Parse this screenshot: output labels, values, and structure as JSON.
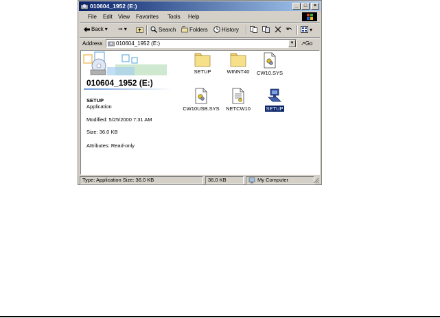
{
  "window": {
    "title": "010604_1952 (E:)",
    "controls": {
      "minimize": "_",
      "maximize": "□",
      "close": "×"
    }
  },
  "menubar": {
    "items": [
      "File",
      "Edit",
      "View",
      "Favorites",
      "Tools",
      "Help"
    ]
  },
  "toolbar": {
    "back_label": "Back",
    "forward_arrow": "⇒",
    "search_label": "Search",
    "folders_label": "Folders",
    "history_label": "History"
  },
  "address": {
    "label": "Address",
    "value": "010604_1952 (E:)",
    "go_label": "Go"
  },
  "webview": {
    "drive_title": "010604_1952 (E:)",
    "selected": {
      "name": "SETUP",
      "type": "Application",
      "modified": "Modified: 5/25/2000 7:31 AM",
      "size": "Size: 36.0 KB",
      "attributes": "Attributes: Read-only"
    }
  },
  "files": [
    {
      "name": "SETUP",
      "icon": "folder-icon"
    },
    {
      "name": "WINNT40",
      "icon": "folder-icon"
    },
    {
      "name": "CW10.SYS",
      "icon": "system-file-icon"
    },
    {
      "name": "CW10USB.SYS",
      "icon": "system-file-icon"
    },
    {
      "name": "NETCW10",
      "icon": "text-document-icon"
    },
    {
      "name": "SETUP",
      "icon": "setup-application-icon",
      "selected": true
    }
  ],
  "statusbar": {
    "info": "Type: Application Size: 36.0 KB",
    "size": "36.0 KB",
    "zone": "My Computer"
  },
  "colors": {
    "titlebar": "#0a246a",
    "selection": "#0a246a",
    "face": "#d4d0c8"
  }
}
